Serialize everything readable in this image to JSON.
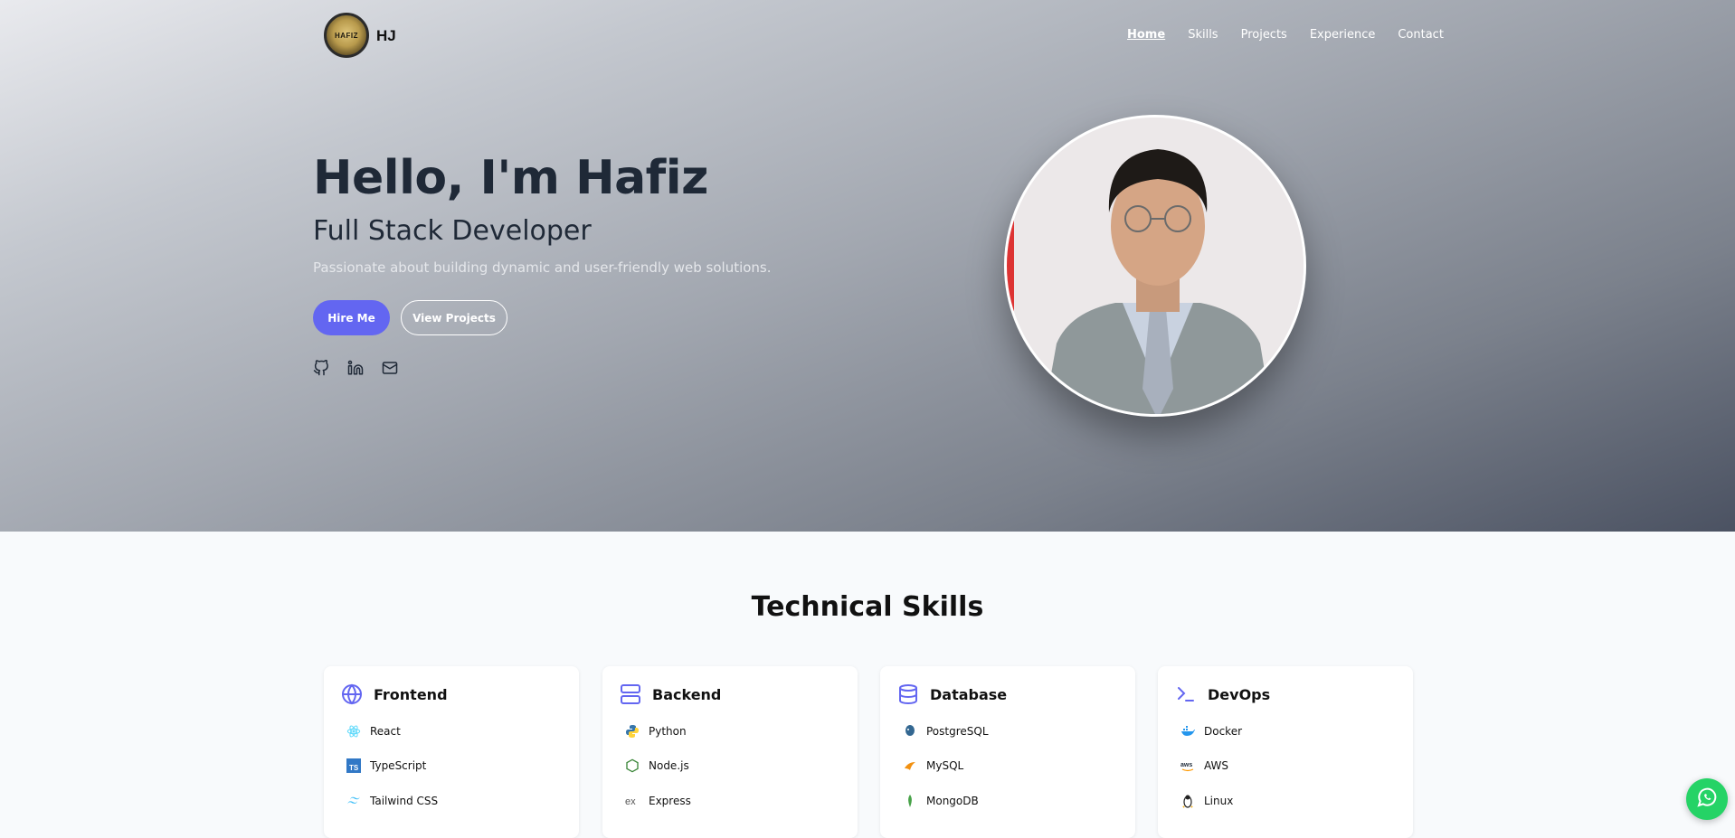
{
  "nav": {
    "logo_text": "HJ",
    "logo_badge": "HAFIZ",
    "links": [
      "Home",
      "Skills",
      "Projects",
      "Experience",
      "Contact"
    ]
  },
  "hero": {
    "title": "Hello, I'm Hafiz",
    "subtitle": "Full Stack Developer",
    "description": "Passionate about building dynamic and user-friendly web solutions.",
    "hire_label": "Hire Me",
    "projects_label": "View Projects"
  },
  "skills": {
    "title": "Technical Skills",
    "cards": [
      {
        "title": "Frontend",
        "items": [
          "React",
          "TypeScript",
          "Tailwind CSS"
        ]
      },
      {
        "title": "Backend",
        "items": [
          "Python",
          "Node.js",
          "Express"
        ]
      },
      {
        "title": "Database",
        "items": [
          "PostgreSQL",
          "MySQL",
          "MongoDB"
        ]
      },
      {
        "title": "DevOps",
        "items": [
          "Docker",
          "AWS",
          "Linux"
        ]
      }
    ]
  },
  "icons": {
    "social": [
      "github-icon",
      "linkedin-icon",
      "mail-icon"
    ],
    "accent": "#6366f1",
    "whatsapp": "#25d366"
  }
}
